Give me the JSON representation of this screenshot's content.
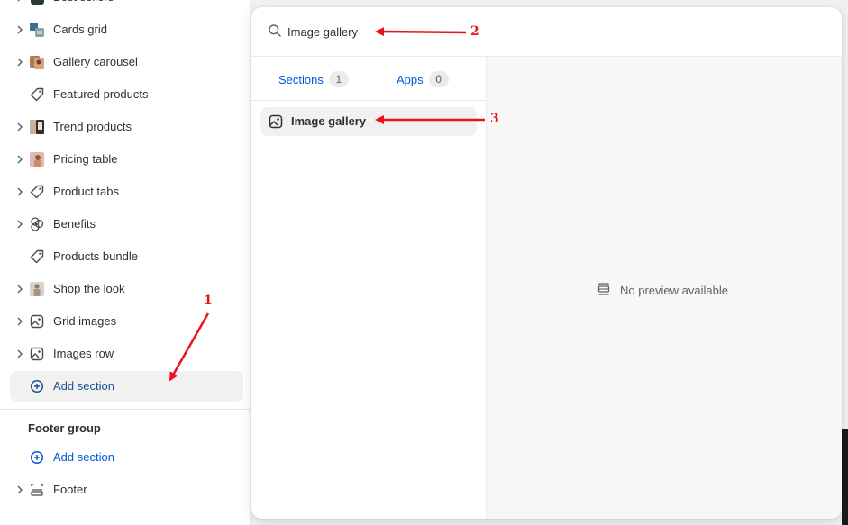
{
  "sidebar": {
    "partial_item": {
      "label": "Best sellers"
    },
    "items": [
      {
        "label": "Cards grid",
        "icon": "cards-grid-thumbnail-icon",
        "expandable": true
      },
      {
        "label": "Gallery carousel",
        "icon": "gallery-carousel-thumbnail-icon",
        "expandable": true
      },
      {
        "label": "Featured products",
        "icon": "tag-icon",
        "expandable": false
      },
      {
        "label": "Trend products",
        "icon": "trend-products-thumbnail-icon",
        "expandable": true
      },
      {
        "label": "Pricing table",
        "icon": "pricing-table-thumbnail-icon",
        "expandable": true
      },
      {
        "label": "Product tabs",
        "icon": "tag-icon",
        "expandable": true
      },
      {
        "label": "Benefits",
        "icon": "benefits-icon",
        "expandable": true
      },
      {
        "label": "Products bundle",
        "icon": "tag-icon",
        "expandable": false
      },
      {
        "label": "Shop the look",
        "icon": "shop-the-look-thumbnail-icon",
        "expandable": true
      },
      {
        "label": "Grid images",
        "icon": "image-icon",
        "expandable": true
      },
      {
        "label": "Images row",
        "icon": "image-icon",
        "expandable": true
      }
    ],
    "add_section_label": "Add section",
    "footer_group": {
      "title": "Footer group",
      "add_section_label": "Add section",
      "footer_label": "Footer"
    }
  },
  "popover": {
    "search": {
      "value": "Image gallery",
      "icon": "search-icon"
    },
    "tabs": [
      {
        "label": "Sections",
        "count": "1"
      },
      {
        "label": "Apps",
        "count": "0"
      }
    ],
    "results": [
      {
        "label": "Image gallery",
        "icon": "image-icon"
      }
    ],
    "preview": {
      "empty_text": "No preview available",
      "icon": "preview-icon"
    }
  },
  "annotations": {
    "step1": "1",
    "step2": "2",
    "step3": "3",
    "color": "#e8141a"
  },
  "colors": {
    "link": "#005bd3",
    "add_section_active": "#1d4f91",
    "selected_bg": "#f1f1f1",
    "text": "#303030"
  }
}
